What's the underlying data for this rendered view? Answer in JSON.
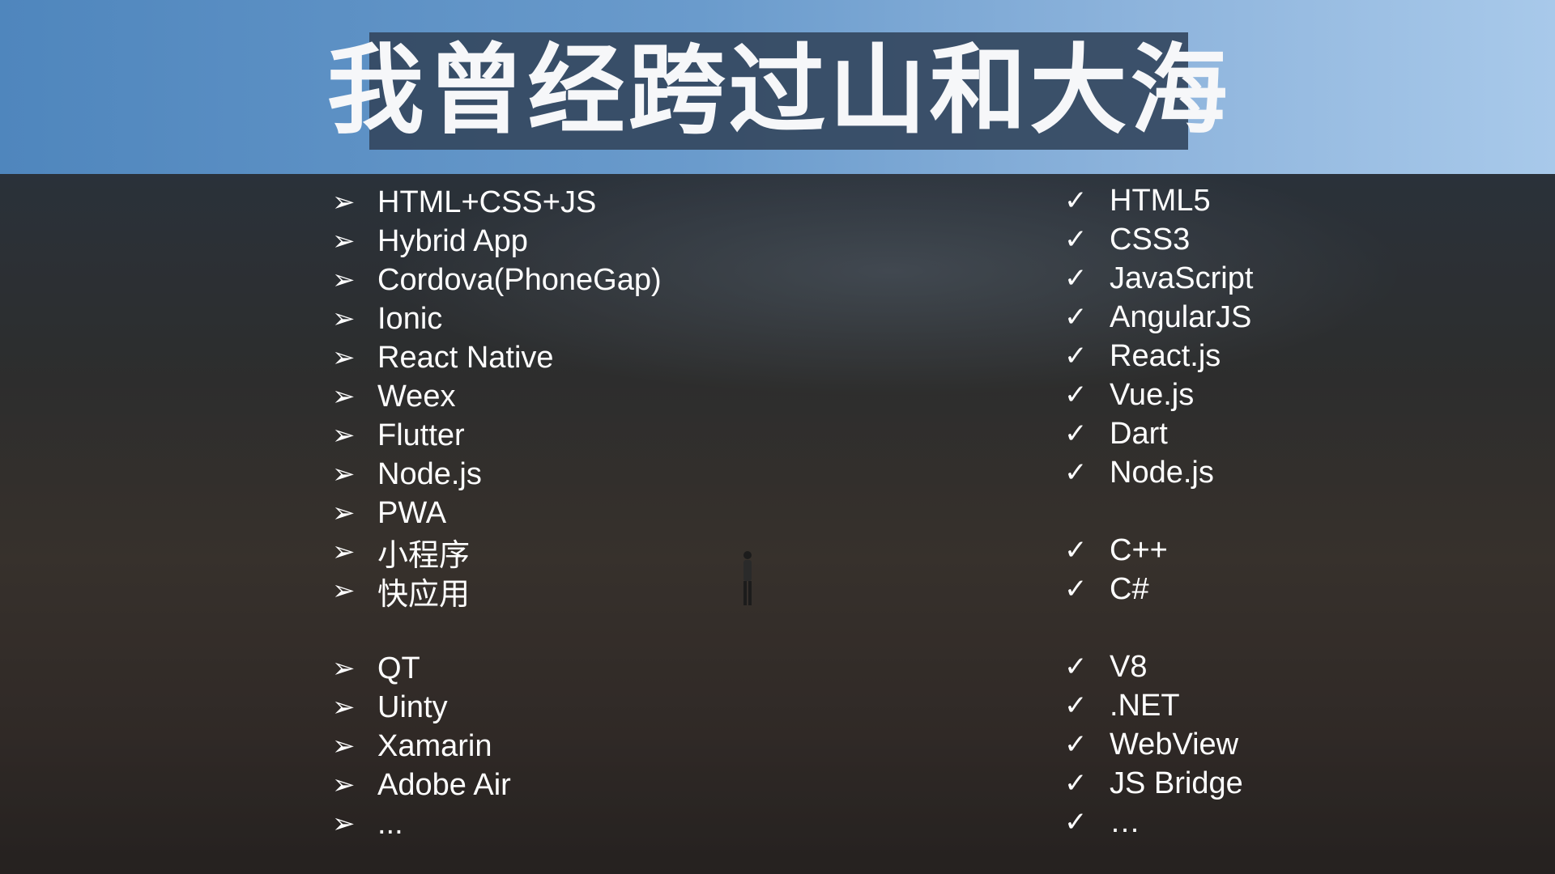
{
  "title": "我曾经跨过山和大海",
  "icons": {
    "left_marker": "arrowhead-bullet-icon",
    "right_marker": "check-mark-icon"
  },
  "colors": {
    "sky": "#6a9bcc",
    "title_box": "#344860",
    "text": "#ffffff"
  },
  "left_list": [
    {
      "label": "HTML+CSS+JS"
    },
    {
      "label": "Hybrid App"
    },
    {
      "label": "Cordova(PhoneGap)"
    },
    {
      "label": "Ionic"
    },
    {
      "label": "React Native"
    },
    {
      "label": "Weex"
    },
    {
      "label": "Flutter"
    },
    {
      "label": "Node.js"
    },
    {
      "label": "PWA"
    },
    {
      "label": "小程序"
    },
    {
      "label": "快应用"
    },
    {
      "label": ""
    },
    {
      "label": "QT"
    },
    {
      "label": "Uinty"
    },
    {
      "label": "Xamarin"
    },
    {
      "label": "Adobe Air"
    },
    {
      "label": "..."
    }
  ],
  "right_list": [
    {
      "label": "HTML5"
    },
    {
      "label": "CSS3"
    },
    {
      "label": "JavaScript"
    },
    {
      "label": "AngularJS"
    },
    {
      "label": "React.js"
    },
    {
      "label": "Vue.js"
    },
    {
      "label": "Dart"
    },
    {
      "label": "Node.js"
    },
    {
      "label": ""
    },
    {
      "label": "C++"
    },
    {
      "label": "C#"
    },
    {
      "label": ""
    },
    {
      "label": "V8"
    },
    {
      "label": ".NET"
    },
    {
      "label": "WebView"
    },
    {
      "label": "JS Bridge"
    },
    {
      "label": "…"
    }
  ]
}
